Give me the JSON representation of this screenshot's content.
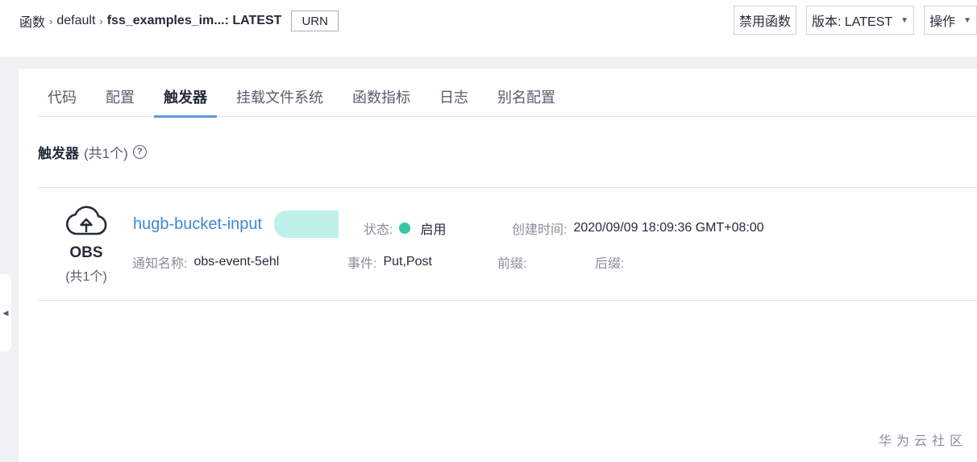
{
  "breadcrumb": {
    "root": "函数",
    "app": "default",
    "function": "fss_examples_im...",
    "version": ": LATEST",
    "urn_label": "URN"
  },
  "top_actions": {
    "disable_label": "禁用函数",
    "version_select": "版本: LATEST",
    "operate_select": "操作"
  },
  "tabs": [
    {
      "label": "代码",
      "active": false
    },
    {
      "label": "配置",
      "active": false
    },
    {
      "label": "触发器",
      "active": true
    },
    {
      "label": "挂载文件系统",
      "active": false
    },
    {
      "label": "函数指标",
      "active": false
    },
    {
      "label": "日志",
      "active": false
    },
    {
      "label": "别名配置",
      "active": false
    }
  ],
  "section": {
    "title": "触发器",
    "count": "(共1个)"
  },
  "trigger": {
    "icon": "cloud-upload-icon",
    "type": "OBS",
    "type_count": "(共1个)",
    "name": "hugb-bucket-input",
    "status_label": "状态:",
    "status_value": "启用",
    "status_color": "#38c6a3",
    "created_label": "创建时间:",
    "created_value": "2020/09/09 18:09:36 GMT+08:00",
    "notify_label": "通知名称:",
    "notify_value": "obs-event-5ehl",
    "event_label": "事件:",
    "event_value": "Put,Post",
    "prefix_label": "前缀:",
    "suffix_label": "后缀:"
  },
  "watermark": "华为云社区",
  "colors": {
    "accent": "#5e9bd9",
    "link": "#3f87d5",
    "status_enabled": "#38c6a3"
  }
}
